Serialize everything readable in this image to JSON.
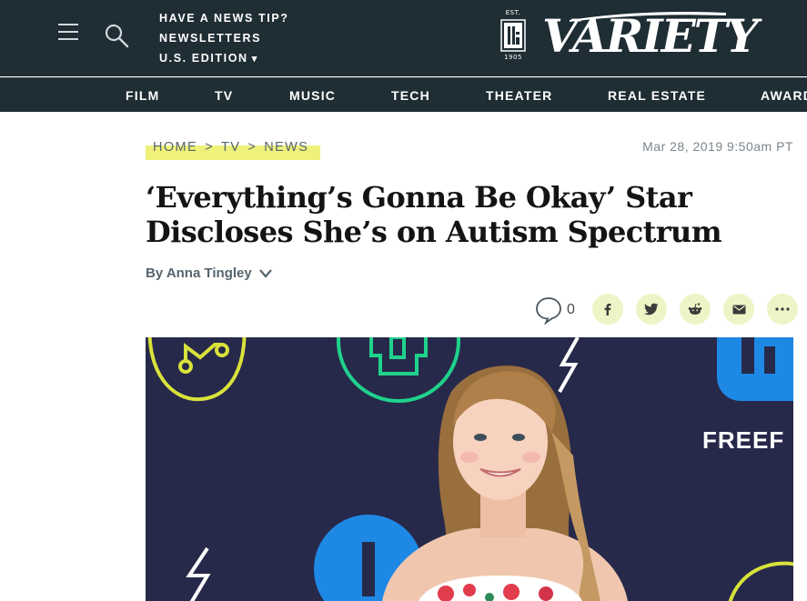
{
  "header": {
    "links": {
      "news_tip": "HAVE A NEWS TIP?",
      "newsletters": "NEWSLETTERS",
      "edition": "U.S. EDITION",
      "edition_caret": "▾"
    },
    "est_badge": {
      "top": "EST.",
      "year": "1905"
    },
    "brand": "VARIETY",
    "icons": {
      "menu": "hamburger-icon",
      "search": "search-icon"
    },
    "background": "#1f2d34"
  },
  "nav": {
    "items": [
      "FILM",
      "TV",
      "MUSIC",
      "TECH",
      "THEATER",
      "REAL ESTATE",
      "AWARDS"
    ]
  },
  "article": {
    "breadcrumb": [
      "HOME",
      ">",
      "TV",
      ">",
      "NEWS"
    ],
    "timestamp": "Mar 28, 2019 9:50am PT",
    "headline_line1": "‘Everything’s Gonna Be Okay’ Star",
    "headline_line2": "Discloses She’s on Autism Spectrum",
    "byline_prefix": "By",
    "author": "Anna Tingley"
  },
  "share": {
    "comment_count": "0",
    "buttons": [
      "facebook-icon",
      "twitter-icon",
      "reddit-icon",
      "email-icon",
      "more-icon"
    ]
  },
  "hero": {
    "backdrop_text": "FREEF",
    "backdrop_color": "#27294a"
  },
  "colors": {
    "highlight": "#eff27a",
    "share_circle": "#eff4c6",
    "accent_green": "#1fd28c",
    "accent_yellow": "#d8e23a",
    "accent_blue": "#1e88e5"
  }
}
